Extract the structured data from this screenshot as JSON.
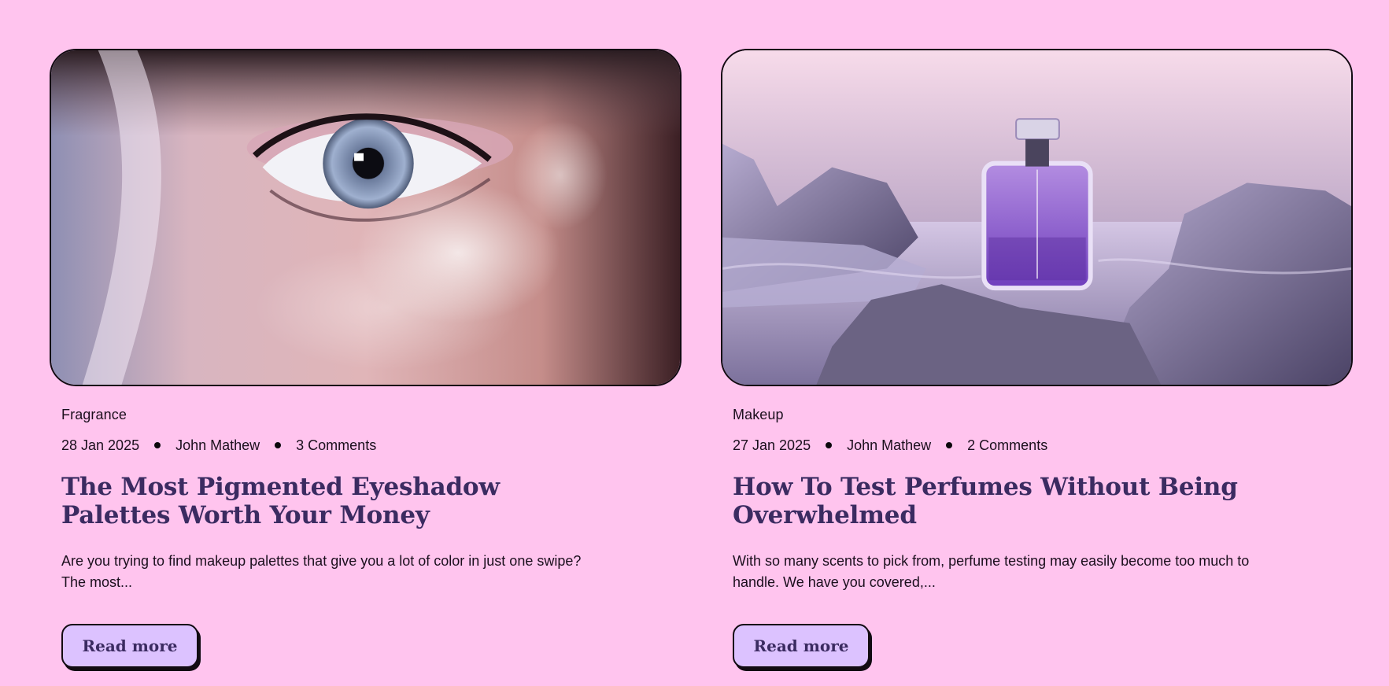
{
  "posts": [
    {
      "category": "Fragrance",
      "date": "28 Jan 2025",
      "author": "John Mathew",
      "comments": "3 Comments",
      "title": "The Most Pigmented Eyeshadow Palettes Worth Your Money",
      "excerpt": "Are you trying to find makeup palettes that give you a lot of color in just one swipe? The most...",
      "button": "Read more"
    },
    {
      "category": "Makeup",
      "date": "27 Jan 2025",
      "author": "John Mathew",
      "comments": "2 Comments",
      "title": "How To Test Perfumes Without Being Overwhelmed",
      "excerpt": "With so many scents to pick from, perfume testing may easily become too much to handle. We have you covered,...",
      "button": "Read more"
    }
  ],
  "colors": {
    "page_background": "#ffc4ee",
    "title": "#3b2b61",
    "button_background": "#dcc2ff",
    "border": "#120b12"
  }
}
